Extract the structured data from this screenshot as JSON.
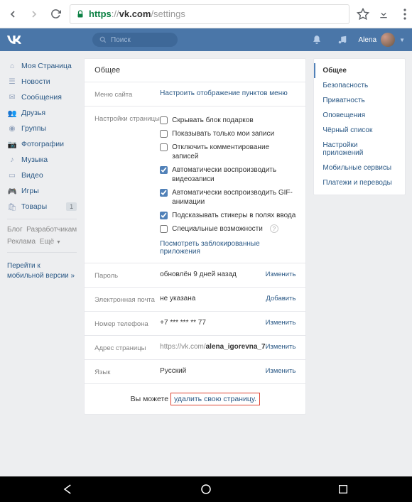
{
  "browser": {
    "url_https": "https",
    "url_sep": "://",
    "url_domain": "vk.com",
    "url_path": "/settings"
  },
  "header": {
    "search_placeholder": "Поиск",
    "username": "Alena"
  },
  "left_nav": {
    "items": [
      {
        "label": "Моя Страница"
      },
      {
        "label": "Новости"
      },
      {
        "label": "Сообщения"
      },
      {
        "label": "Друзья"
      },
      {
        "label": "Группы"
      },
      {
        "label": "Фотографии"
      },
      {
        "label": "Музыка"
      },
      {
        "label": "Видео"
      },
      {
        "label": "Игры"
      },
      {
        "label": "Товары",
        "badge": "1"
      }
    ],
    "sub1": "Блог",
    "sub2": "Разработчикам",
    "sub3": "Реклама",
    "sub4": "Ещё",
    "mobile": "Перейти к мобильной версии »"
  },
  "settings": {
    "title": "Общее",
    "menu_label": "Меню сайта",
    "menu_value": "Настроить отображение пунктов меню",
    "page_label": "Настройки страницы",
    "chk1": "Скрывать блок подарков",
    "chk2": "Показывать только мои записи",
    "chk3": "Отключить комментирование записей",
    "chk4": "Автоматически воспроизводить видеозаписи",
    "chk5": "Автоматически воспроизводить GIF-анимации",
    "chk6": "Подсказывать стикеры в полях ввода",
    "chk7": "Специальные возможности",
    "blocked": "Посмотреть заблокированные приложения",
    "password_label": "Пароль",
    "password_value": "обновлён 9 дней назад",
    "email_label": "Электронная почта",
    "email_value": "не указана",
    "phone_label": "Номер телефона",
    "phone_value": "+7 *** *** ** 77",
    "address_label": "Адрес страницы",
    "address_prefix": "https://vk.com/",
    "address_suffix": "alena_igorevna_7",
    "lang_label": "Язык",
    "lang_value": "Русский",
    "action_change": "Изменить",
    "action_add": "Добавить",
    "delete_prefix": "Вы можете",
    "delete_link": "удалить свою страницу."
  },
  "tabs": [
    "Общее",
    "Безопасность",
    "Приватность",
    "Оповещения",
    "Чёрный список",
    "Настройки приложений",
    "Мобильные сервисы",
    "Платежи и переводы"
  ]
}
